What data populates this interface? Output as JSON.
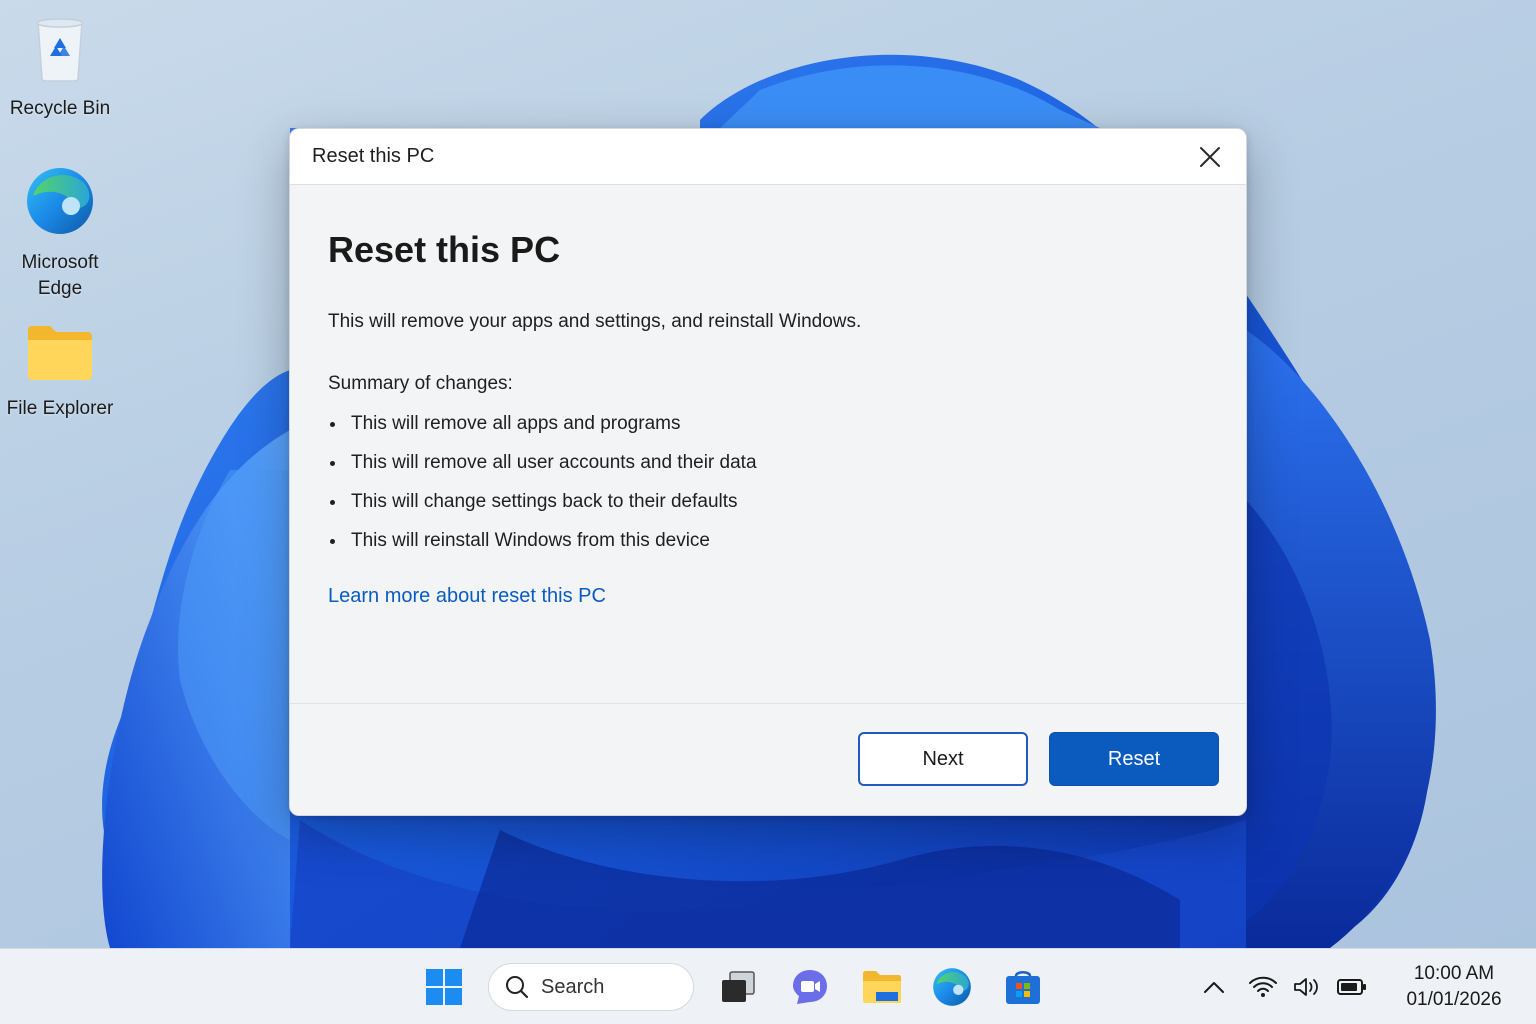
{
  "desktop": {
    "icons": [
      {
        "label": "Recycle Bin",
        "icon": "recycle-bin-icon"
      },
      {
        "label": "Microsoft Edge",
        "icon": "edge-icon"
      },
      {
        "label": "File Explorer",
        "icon": "folder-icon"
      }
    ]
  },
  "dialog": {
    "window_title": "Reset this PC",
    "heading": "Reset this PC",
    "description": "This will remove your apps and settings, and reinstall Windows.",
    "summary_label": "Summary of changes:",
    "changes": [
      "This will remove all apps and programs",
      "This will remove all user accounts and their data",
      "This will change settings back to their defaults",
      "This will reinstall Windows from this device"
    ],
    "learn_more": "Learn more about reset this PC",
    "next_label": "Next",
    "reset_label": "Reset",
    "accent_color": "#0b5bbf",
    "link_color": "#0a5cc2"
  },
  "taskbar": {
    "search_placeholder": "Search",
    "apps": [
      "start-icon",
      "task-view-icon",
      "teams-chat-icon",
      "file-explorer-icon",
      "edge-icon",
      "store-icon"
    ],
    "tray": [
      "chevron-up-icon",
      "wifi-icon",
      "volume-icon",
      "battery-icon"
    ],
    "time": "10:00 AM",
    "date": "01/01/2026"
  }
}
